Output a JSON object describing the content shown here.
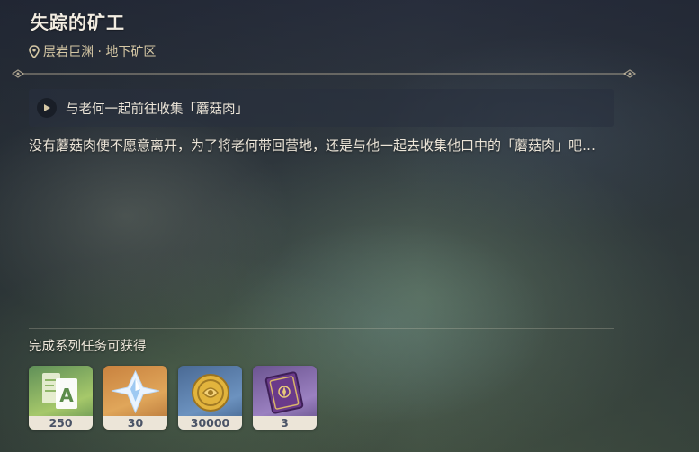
{
  "quest": {
    "title": "失踪的矿工",
    "location": "层岩巨渊 · 地下矿区",
    "objective": "与老何一起前往收集「蘑菇肉」",
    "description": "没有蘑菇肉便不愿意离开，为了将老何带回营地，还是与他一起去收集他口中的「蘑菇肉」吧…"
  },
  "rewards": {
    "title": "完成系列任务可获得",
    "items": [
      {
        "icon": "adventure-exp-icon",
        "count": "250",
        "color": "#7fae5a"
      },
      {
        "icon": "primogem-icon",
        "count": "30",
        "color": "#d6934a"
      },
      {
        "icon": "mora-icon",
        "count": "30000",
        "color": "#5a7eaa"
      },
      {
        "icon": "heros-wit-book-icon",
        "count": "3",
        "color": "#8268aa"
      }
    ]
  },
  "colors": {
    "title_text": "#f3ede2",
    "location_text": "#d6c8a5",
    "count_bg": "#ece5d8",
    "count_text": "#4a5366"
  }
}
